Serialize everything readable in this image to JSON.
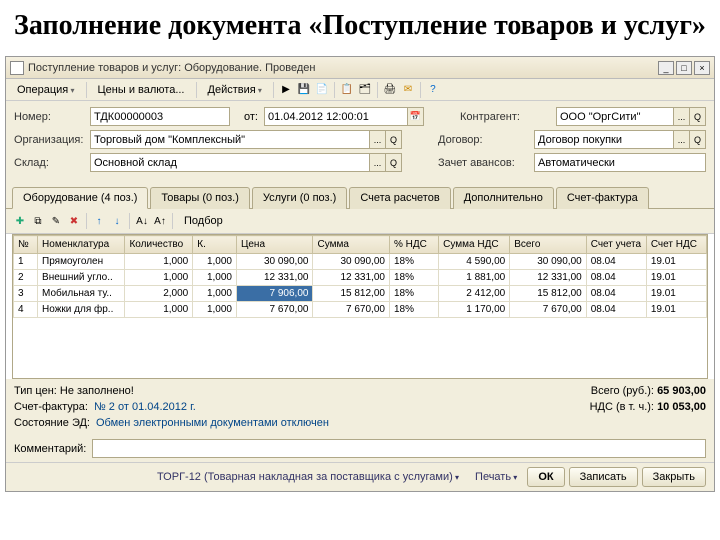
{
  "slide": {
    "heading": "Заполнение документа «Поступление товаров и услуг»"
  },
  "window": {
    "title": "Поступление товаров и услуг: Оборудование. Проведен",
    "min_icon": "_",
    "max_icon": "□",
    "close_icon": "×"
  },
  "menu": {
    "operation": "Операция",
    "prices": "Цены и валюта...",
    "actions": "Действия"
  },
  "header": {
    "number_lbl": "Номер:",
    "number_val": "ТДК00000003",
    "date_lbl": "от:",
    "date_val": "01.04.2012 12:00:01",
    "org_lbl": "Организация:",
    "org_val": "Торговый дом \"Комплексный\"",
    "warehouse_lbl": "Склад:",
    "warehouse_val": "Основной склад",
    "counter_lbl": "Контрагент:",
    "counter_val": "ООО \"ОргСити\"",
    "contract_lbl": "Договор:",
    "contract_val": "Договор покупки",
    "advance_lbl": "Зачет авансов:",
    "advance_val": "Автоматически"
  },
  "tabs": {
    "t1": "Оборудование (4 поз.)",
    "t2": "Товары (0 поз.)",
    "t3": "Услуги (0 поз.)",
    "t4": "Счета расчетов",
    "t5": "Дополнительно",
    "t6": "Счет-фактура"
  },
  "subtoolbar": {
    "pick": "Подбор"
  },
  "grid": {
    "cols": {
      "n": "№",
      "nom": "Номенклатура",
      "qty": "Количество",
      "k": "К.",
      "price": "Цена",
      "sum": "Сумма",
      "vat_pct": "% НДС",
      "vat_sum": "Сумма НДС",
      "total": "Всего",
      "acct": "Счет учета",
      "acct_vat": "Счет НДС"
    },
    "rows": [
      {
        "n": "1",
        "nom": "Прямоуголен",
        "qty": "1,000",
        "k": "1,000",
        "price": "30 090,00",
        "sum": "30 090,00",
        "vat_pct": "18%",
        "vat_sum": "4 590,00",
        "total": "30 090,00",
        "acct": "08.04",
        "acct_vat": "19.01"
      },
      {
        "n": "2",
        "nom": "Внешний угло..",
        "qty": "1,000",
        "k": "1,000",
        "price": "12 331,00",
        "sum": "12 331,00",
        "vat_pct": "18%",
        "vat_sum": "1 881,00",
        "total": "12 331,00",
        "acct": "08.04",
        "acct_vat": "19.01"
      },
      {
        "n": "3",
        "nom": "Мобильная ту..",
        "qty": "2,000",
        "k": "1,000",
        "price": "7 906,00",
        "sum": "15 812,00",
        "vat_pct": "18%",
        "vat_sum": "2 412,00",
        "total": "15 812,00",
        "acct": "08.04",
        "acct_vat": "19.01"
      },
      {
        "n": "4",
        "nom": "Ножки для фр..",
        "qty": "1,000",
        "k": "1,000",
        "price": "7 670,00",
        "sum": "7 670,00",
        "vat_pct": "18%",
        "vat_sum": "1 170,00",
        "total": "7 670,00",
        "acct": "08.04",
        "acct_vat": "19.01"
      }
    ]
  },
  "footer": {
    "price_type_lbl": "Тип цен: Не заполнено!",
    "total_lbl": "Всего (руб.):",
    "total_val": "65 903,00",
    "invoice_lbl": "Счет-фактура:",
    "invoice_val": "№ 2 от 01.04.2012 г.",
    "vat_lbl": "НДС (в т. ч.):",
    "vat_val": "10 053,00",
    "ed_state_lbl": "Состояние ЭД:",
    "ed_state_val": "Обмен электронными документами отключен",
    "comment_lbl": "Комментарий:"
  },
  "bottom": {
    "torg": "ТОРГ-12 (Товарная накладная за поставщика с услугами)",
    "print": "Печать",
    "ok": "ОК",
    "save": "Записать",
    "close": "Закрыть"
  }
}
